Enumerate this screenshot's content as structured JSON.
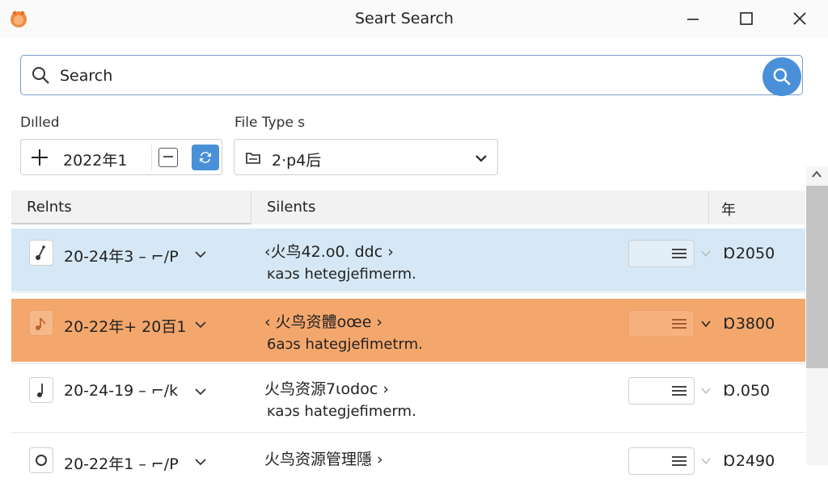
{
  "window": {
    "title": "Seart Search"
  },
  "search": {
    "placeholder": "Search"
  },
  "filters": {
    "date_label": "Dılled",
    "date_value": "2022年1",
    "type_label": "File Type s",
    "type_value": "2·p4后"
  },
  "table": {
    "headers": [
      "Relnts",
      "Silents",
      "年"
    ],
    "rows": [
      {
        "date": "20-24年3 – ⌐/P",
        "name": "‹火鸟42.o0. ddc ›",
        "desc": "ĸaɔs hetegjefimerm.",
        "size": "Ɒ2050"
      },
      {
        "date": "20-22年+ 20百1",
        "name": "‹ 火鸟资體oœe ›",
        "desc": "6aɔs hategjefimetrm.",
        "size": "Ɒ3800"
      },
      {
        "date": "20-24-19 – ⌐/k",
        "name": "火鸟资源7ιodoc ›",
        "desc": "ĸaɔs hategjefimerm.",
        "size": "Ɒ.050"
      },
      {
        "date": "20-22年1 – ⌐/P",
        "name": "火鸟资源管理隱 ›",
        "desc": "",
        "size": "Ɒ2490"
      }
    ]
  },
  "colors": {
    "accent": "#4a90d9",
    "row_selected": "#d6e8f5",
    "row_highlight": "#f4a76c"
  },
  "icons": {
    "app": "fox-logo-icon",
    "search": "magnifier-icon",
    "row": "music-note-icon",
    "menu": "hamburger-icon"
  }
}
